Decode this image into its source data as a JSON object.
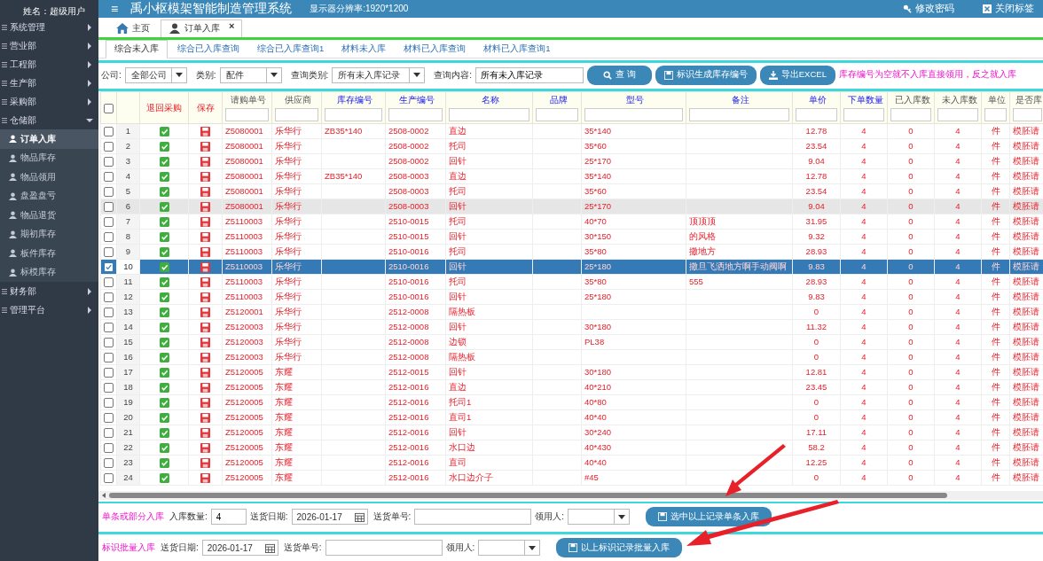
{
  "user": {
    "name": "姓名：超级用户"
  },
  "sidebar": {
    "items": [
      {
        "label": "系统管理",
        "expanded": false
      },
      {
        "label": "营业部",
        "expanded": false
      },
      {
        "label": "工程部",
        "expanded": false
      },
      {
        "label": "生产部",
        "expanded": false
      },
      {
        "label": "采购部",
        "expanded": false
      },
      {
        "label": "仓储部",
        "expanded": true,
        "children": [
          {
            "label": "订单入库",
            "selected": true
          },
          {
            "label": "物品库存",
            "selected": false
          },
          {
            "label": "物品领用",
            "selected": false
          },
          {
            "label": "盘盈盘亏",
            "selected": false
          },
          {
            "label": "物品退货",
            "selected": false
          },
          {
            "label": "期初库存",
            "selected": false
          },
          {
            "label": "板件库存",
            "selected": false
          },
          {
            "label": "标模库存",
            "selected": false
          }
        ]
      },
      {
        "label": "财务部",
        "expanded": false
      },
      {
        "label": "管理平台",
        "expanded": false
      }
    ]
  },
  "header": {
    "menu_icon": "≡",
    "title": "禹小枢模架智能制造管理系统",
    "resolution": "显示器分辨率:1920*1200",
    "actions": [
      "修改密码",
      "关闭标签"
    ]
  },
  "tabs": [
    {
      "label": "主页",
      "selected": false,
      "closable": false
    },
    {
      "label": "订单入库",
      "selected": true,
      "closable": true,
      "close": "×"
    }
  ],
  "subtabs": [
    {
      "label": "综合未入库",
      "selected": true
    },
    {
      "label": "综合已入库查询",
      "selected": false
    },
    {
      "label": "综合已入库查询1",
      "selected": false
    },
    {
      "label": "材料未入库",
      "selected": false
    },
    {
      "label": "材料已入库查询",
      "selected": false
    },
    {
      "label": "材料已入库查询1",
      "selected": false
    }
  ],
  "filters": {
    "company_label": "公司:",
    "company": "全部公司",
    "category_label": "类别:",
    "category": "配件",
    "query_type_label": "查询类别:",
    "query_type": "所有未入库记录",
    "query_label": "查询内容:",
    "query": "所有未入库记录",
    "buttons": [
      "查 询",
      "标识生成库存编号",
      "导出EXCEL"
    ],
    "note": "库存编号为空就不入库直接领用，反之就入库"
  },
  "table": {
    "all_checked": false,
    "columns": [
      {
        "label": "退回采购",
        "kind": "action",
        "filter": false
      },
      {
        "label": "保存",
        "kind": "action",
        "filter": false
      },
      {
        "label": "请购单号",
        "kind": "plain",
        "filter": true
      },
      {
        "label": "供应商",
        "kind": "plain",
        "filter": true
      },
      {
        "label": "库存编号",
        "kind": "key",
        "filter": true
      },
      {
        "label": "生产编号",
        "kind": "key",
        "filter": true
      },
      {
        "label": "名称",
        "kind": "key",
        "filter": true
      },
      {
        "label": "品牌",
        "kind": "key",
        "filter": true
      },
      {
        "label": "型号",
        "kind": "key",
        "filter": true
      },
      {
        "label": "备注",
        "kind": "key",
        "filter": true
      },
      {
        "label": "单价",
        "kind": "key",
        "filter": true
      },
      {
        "label": "下单数量",
        "kind": "key",
        "filter": true
      },
      {
        "label": "已入库数",
        "kind": "plain",
        "filter": true
      },
      {
        "label": "未入库数",
        "kind": "plain",
        "filter": true
      },
      {
        "label": "单位",
        "kind": "plain",
        "filter": true
      },
      {
        "label": "是否库",
        "kind": "plain",
        "filter": true
      }
    ],
    "rows": [
      {
        "no": "1",
        "selected": false,
        "hovered": false,
        "order": "Z5080001",
        "supplier": "乐华行",
        "stock_no": "ZB35*140",
        "prod_no": "2508-0002",
        "name": "直边",
        "model": "35*140",
        "price": "12.78",
        "ordered": "4",
        "received": "0",
        "pending": "4",
        "unit": "件",
        "flag": "模胚请"
      },
      {
        "no": "2",
        "selected": false,
        "hovered": false,
        "order": "Z5080001",
        "supplier": "乐华行",
        "prod_no": "2508-0002",
        "name": "托司",
        "model": "35*60",
        "price": "23.54",
        "ordered": "4",
        "received": "0",
        "pending": "4",
        "unit": "件",
        "flag": "模胚请"
      },
      {
        "no": "3",
        "selected": false,
        "hovered": false,
        "order": "Z5080001",
        "supplier": "乐华行",
        "prod_no": "2508-0002",
        "name": "回针",
        "model": "25*170",
        "price": "9.04",
        "ordered": "4",
        "received": "0",
        "pending": "4",
        "unit": "件",
        "flag": "模胚请"
      },
      {
        "no": "4",
        "selected": false,
        "hovered": false,
        "order": "Z5080001",
        "supplier": "乐华行",
        "stock_no": "ZB35*140",
        "prod_no": "2508-0003",
        "name": "直边",
        "model": "35*140",
        "price": "12.78",
        "ordered": "4",
        "received": "0",
        "pending": "4",
        "unit": "件",
        "flag": "模胚请"
      },
      {
        "no": "5",
        "selected": false,
        "hovered": false,
        "order": "Z5080001",
        "supplier": "乐华行",
        "prod_no": "2508-0003",
        "name": "托司",
        "model": "35*60",
        "price": "23.54",
        "ordered": "4",
        "received": "0",
        "pending": "4",
        "unit": "件",
        "flag": "模胚请"
      },
      {
        "no": "6",
        "selected": false,
        "hovered": true,
        "order": "Z5080001",
        "supplier": "乐华行",
        "prod_no": "2508-0003",
        "name": "回针",
        "model": "25*170",
        "price": "9.04",
        "ordered": "4",
        "received": "0",
        "pending": "4",
        "unit": "件",
        "flag": "模胚请"
      },
      {
        "no": "7",
        "selected": false,
        "hovered": false,
        "order": "Z5110003",
        "supplier": "乐华行",
        "prod_no": "2510-0015",
        "name": "托司",
        "model": "40*70",
        "note": "顶顶顶",
        "price": "31.95",
        "ordered": "4",
        "received": "0",
        "pending": "4",
        "unit": "件",
        "flag": "模胚请"
      },
      {
        "no": "8",
        "selected": false,
        "hovered": false,
        "order": "Z5110003",
        "supplier": "乐华行",
        "prod_no": "2510-0015",
        "name": "回针",
        "model": "30*150",
        "note": "的风格",
        "price": "9.32",
        "ordered": "4",
        "received": "0",
        "pending": "4",
        "unit": "件",
        "flag": "模胚请"
      },
      {
        "no": "9",
        "selected": false,
        "hovered": false,
        "order": "Z5110003",
        "supplier": "乐华行",
        "prod_no": "2510-0016",
        "name": "托司",
        "model": "35*80",
        "note": "撒地方",
        "price": "28.93",
        "ordered": "4",
        "received": "0",
        "pending": "4",
        "unit": "件",
        "flag": "模胚请"
      },
      {
        "no": "10",
        "selected": true,
        "hovered": false,
        "order": "Z5110003",
        "supplier": "乐华行",
        "prod_no": "2510-0016",
        "name": "回针",
        "model": "25*180",
        "note": "撒旦飞洒地方啊手动阀啊",
        "price": "9.83",
        "ordered": "4",
        "received": "0",
        "pending": "4",
        "unit": "件",
        "flag": "模胚请"
      },
      {
        "no": "11",
        "selected": false,
        "hovered": false,
        "order": "Z5110003",
        "supplier": "乐华行",
        "prod_no": "2510-0016",
        "name": "托司",
        "model": "35*80",
        "note": "555",
        "price": "28.93",
        "ordered": "4",
        "received": "0",
        "pending": "4",
        "unit": "件",
        "flag": "模胚请"
      },
      {
        "no": "12",
        "selected": false,
        "hovered": false,
        "order": "Z5110003",
        "supplier": "乐华行",
        "prod_no": "2510-0016",
        "name": "回针",
        "model": "25*180",
        "price": "9.83",
        "ordered": "4",
        "received": "0",
        "pending": "4",
        "unit": "件",
        "flag": "模胚请"
      },
      {
        "no": "13",
        "selected": false,
        "hovered": false,
        "order": "Z5120001",
        "supplier": "乐华行",
        "prod_no": "2512-0008",
        "name": "隔热板",
        "price": "0",
        "ordered": "4",
        "received": "0",
        "pending": "4",
        "unit": "件",
        "flag": "模胚请"
      },
      {
        "no": "14",
        "selected": false,
        "hovered": false,
        "order": "Z5120003",
        "supplier": "乐华行",
        "prod_no": "2512-0008",
        "name": "回针",
        "model": "30*180",
        "price": "11.32",
        "ordered": "4",
        "received": "0",
        "pending": "4",
        "unit": "件",
        "flag": "模胚请"
      },
      {
        "no": "15",
        "selected": false,
        "hovered": false,
        "order": "Z5120003",
        "supplier": "乐华行",
        "prod_no": "2512-0008",
        "name": "边锁",
        "model": "PL38",
        "price": "0",
        "ordered": "4",
        "received": "0",
        "pending": "4",
        "unit": "件",
        "flag": "模胚请"
      },
      {
        "no": "16",
        "selected": false,
        "hovered": false,
        "order": "Z5120003",
        "supplier": "乐华行",
        "prod_no": "2512-0008",
        "name": "隔热板",
        "price": "0",
        "ordered": "4",
        "received": "0",
        "pending": "4",
        "unit": "件",
        "flag": "模胚请"
      },
      {
        "no": "17",
        "selected": false,
        "hovered": false,
        "order": "Z5120005",
        "supplier": "东耀",
        "prod_no": "2512-0015",
        "name": "回针",
        "model": "30*180",
        "price": "12.81",
        "ordered": "4",
        "received": "0",
        "pending": "4",
        "unit": "件",
        "flag": "模胚请"
      },
      {
        "no": "18",
        "selected": false,
        "hovered": false,
        "order": "Z5120005",
        "supplier": "东耀",
        "prod_no": "2512-0016",
        "name": "直边",
        "model": "40*210",
        "price": "23.45",
        "ordered": "4",
        "received": "0",
        "pending": "4",
        "unit": "件",
        "flag": "模胚请"
      },
      {
        "no": "19",
        "selected": false,
        "hovered": false,
        "order": "Z5120005",
        "supplier": "东耀",
        "prod_no": "2512-0016",
        "name": "托司1",
        "model": "40*80",
        "price": "0",
        "ordered": "4",
        "received": "0",
        "pending": "4",
        "unit": "件",
        "flag": "模胚请"
      },
      {
        "no": "20",
        "selected": false,
        "hovered": false,
        "order": "Z5120005",
        "supplier": "东耀",
        "prod_no": "2512-0016",
        "name": "直司1",
        "model": "40*40",
        "price": "0",
        "ordered": "4",
        "received": "0",
        "pending": "4",
        "unit": "件",
        "flag": "模胚请"
      },
      {
        "no": "21",
        "selected": false,
        "hovered": false,
        "order": "Z5120005",
        "supplier": "东耀",
        "prod_no": "2512-0016",
        "name": "回针",
        "model": "30*240",
        "price": "17.11",
        "ordered": "4",
        "received": "0",
        "pending": "4",
        "unit": "件",
        "flag": "模胚请"
      },
      {
        "no": "22",
        "selected": false,
        "hovered": false,
        "order": "Z5120005",
        "supplier": "东耀",
        "prod_no": "2512-0016",
        "name": "水口边",
        "model": "40*430",
        "price": "58.2",
        "ordered": "4",
        "received": "0",
        "pending": "4",
        "unit": "件",
        "flag": "模胚请"
      },
      {
        "no": "23",
        "selected": false,
        "hovered": false,
        "order": "Z5120005",
        "supplier": "东耀",
        "prod_no": "2512-0016",
        "name": "直司",
        "model": "40*40",
        "price": "12.25",
        "ordered": "4",
        "received": "0",
        "pending": "4",
        "unit": "件",
        "flag": "模胚请"
      },
      {
        "no": "24",
        "selected": false,
        "hovered": false,
        "order": "Z5120005",
        "supplier": "东耀",
        "prod_no": "2512-0016",
        "name": "水口边介子",
        "model": "#45",
        "price": "0",
        "ordered": "4",
        "received": "0",
        "pending": "4",
        "unit": "件",
        "flag": "模胚请"
      }
    ]
  },
  "single_entry": {
    "title": "单条或部分入库",
    "qty_label": "入库数量:",
    "qty": "4",
    "date_label": "送货日期:",
    "date": "2026-01-17",
    "delivery_label": "送货单号:",
    "receiver_label": "领用人:",
    "button": "选中以上记录单条入库"
  },
  "batch_entry": {
    "title": "标识批量入库",
    "date_label": "送货日期:",
    "date": "2026-01-17",
    "delivery_label": "送货单号:",
    "receiver_label": "领用人:",
    "button": "以上标识记录批量入库"
  }
}
